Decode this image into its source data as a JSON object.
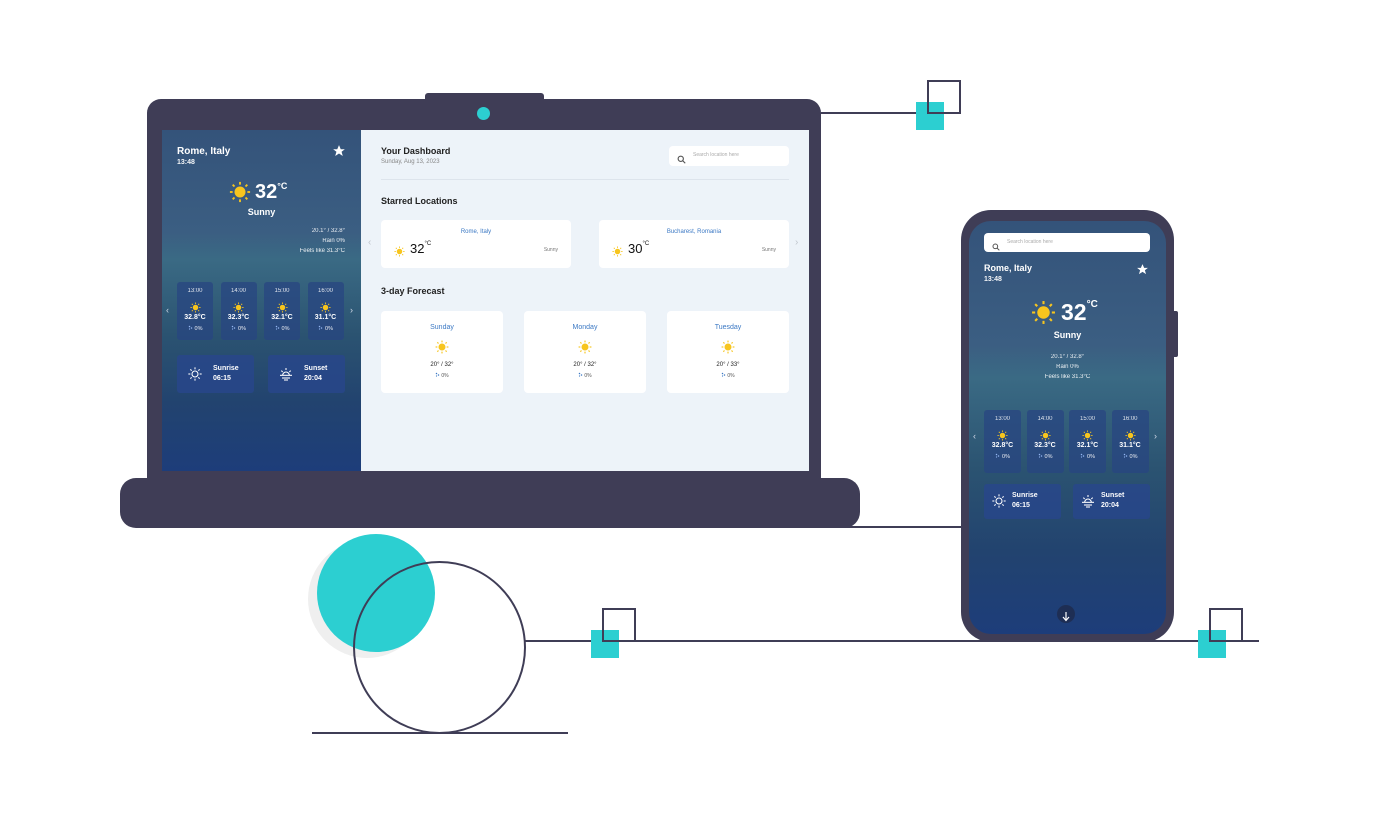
{
  "laptop": {
    "weather": {
      "city": "Rome, Italy",
      "time": "13:48",
      "temp": "32",
      "unit": "°C",
      "condition": "Sunny",
      "range": "20.1° / 32.8°",
      "rain": "Rain 0%",
      "feels": "Feels like 31.3°C",
      "hours": [
        {
          "time": "13:00",
          "temp": "32.8°C",
          "rain": "0%"
        },
        {
          "time": "14:00",
          "temp": "32.3°C",
          "rain": "0%"
        },
        {
          "time": "15:00",
          "temp": "32.1°C",
          "rain": "0%"
        },
        {
          "time": "16:00",
          "temp": "31.1°C",
          "rain": "0%"
        }
      ],
      "sunrise_label": "Sunrise",
      "sunrise_time": "06:15",
      "sunset_label": "Sunset",
      "sunset_time": "20:04"
    },
    "dashboard": {
      "title": "Your Dashboard",
      "date": "Sunday, Aug 13, 2023",
      "search_placeholder": "Search location here",
      "starred_title": "Starred Locations",
      "starred": [
        {
          "city": "Rome, Italy",
          "temp": "32",
          "unit": "°C",
          "condition": "Sunny"
        },
        {
          "city": "Bucharest, Romania",
          "temp": "30",
          "unit": "°C",
          "condition": "Sunny"
        }
      ],
      "forecast_title": "3-day Forecast",
      "forecast": [
        {
          "day": "Sunday",
          "range": "20° / 32°",
          "rain": "0%"
        },
        {
          "day": "Monday",
          "range": "20° / 32°",
          "rain": "0%"
        },
        {
          "day": "Tuesday",
          "range": "20° / 33°",
          "rain": "0%"
        }
      ]
    }
  },
  "phone": {
    "search_placeholder": "Search location here",
    "weather": {
      "city": "Rome, Italy",
      "time": "13:48",
      "temp": "32",
      "unit": "°C",
      "condition": "Sunny",
      "range": "20.1° / 32.8°",
      "rain": "Rain 0%",
      "feels": "Feels like 31.3°C",
      "hours": [
        {
          "time": "13:00",
          "temp": "32.8°C",
          "rain": "0%"
        },
        {
          "time": "14:00",
          "temp": "32.3°C",
          "rain": "0%"
        },
        {
          "time": "15:00",
          "temp": "32.1°C",
          "rain": "0%"
        },
        {
          "time": "16:00",
          "temp": "31.1°C",
          "rain": "0%"
        }
      ],
      "sunrise_label": "Sunrise",
      "sunrise_time": "06:15",
      "sunset_label": "Sunset",
      "sunset_time": "20:04"
    }
  },
  "icons": {
    "star": "star-icon",
    "sun": "sun-icon",
    "search": "search-icon",
    "sunrise": "sunrise-icon",
    "sunset": "sunset-icon",
    "prev": "chevron-left-icon",
    "next": "chevron-right-icon",
    "down": "arrow-down-icon",
    "rain": "raindrops-icon"
  },
  "colors": {
    "device": "#3f3d56",
    "accent": "#2ccfd1",
    "sun": "#f7c51e",
    "link_blue": "#3c79c4",
    "dash_bg": "#edf3f9"
  }
}
